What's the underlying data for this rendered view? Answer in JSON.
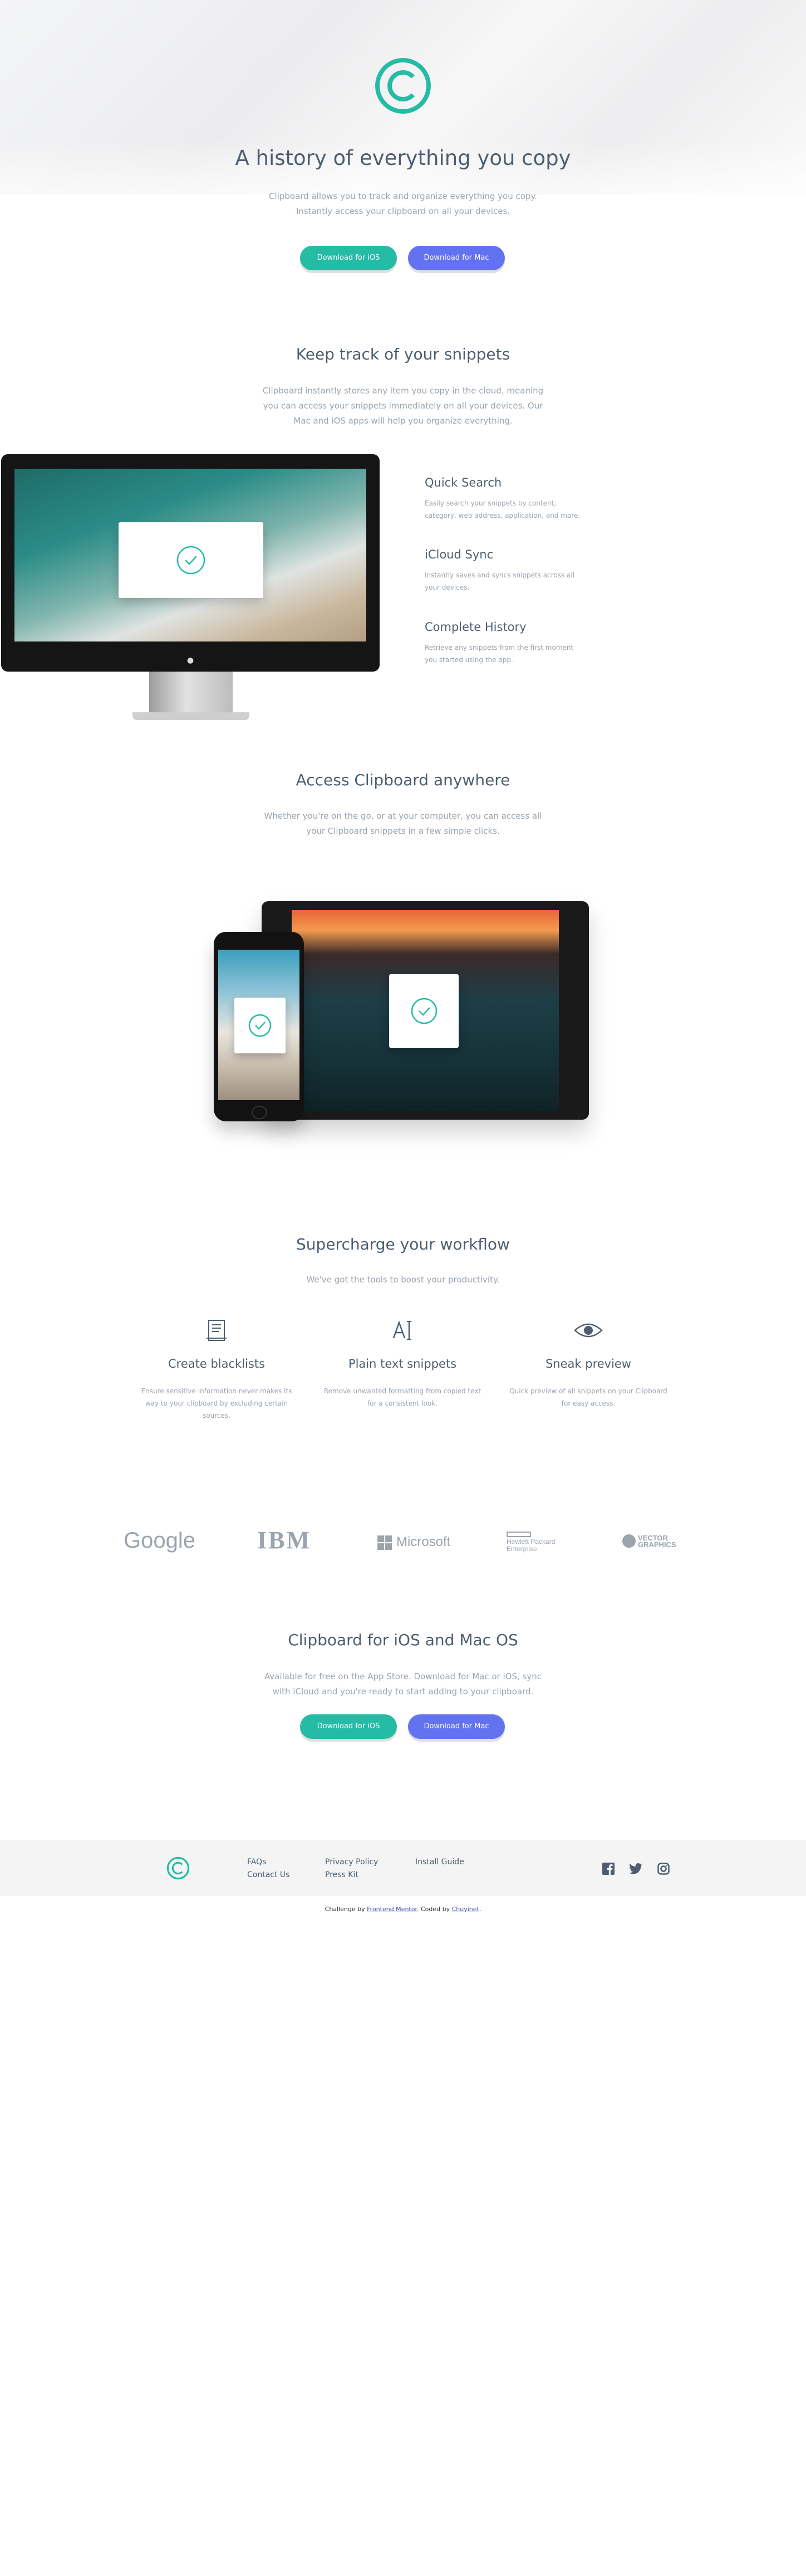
{
  "colors": {
    "accent": "#25bba4",
    "mac": "#6373f0",
    "heading": "#4c5e70",
    "body": "#9aa4ae"
  },
  "hero": {
    "title": "A history of everything you copy",
    "text": "Clipboard allows you to track and organize everything you copy. Instantly access your clipboard on all your devices.",
    "ios_button": "Download for iOS",
    "mac_button": "Download for Mac"
  },
  "snippets": {
    "title": "Keep track of your snippets",
    "text": "Clipboard instantly stores any item you copy in the cloud, meaning you can access your snippets immediately on all your devices. Our Mac and iOS apps will help you organize everything.",
    "features": [
      {
        "title": "Quick Search",
        "text": "Easily search your snippets by content, category, web address, application, and more."
      },
      {
        "title": "iCloud Sync",
        "text": "Instantly saves and syncs snippets across all your devices."
      },
      {
        "title": "Complete History",
        "text": "Retrieve any snippets from the first moment you started using the app."
      }
    ]
  },
  "access": {
    "title": "Access Clipboard anywhere",
    "text": "Whether you're on the go, or at your computer, you can access all your Clipboard snippets in a few simple clicks."
  },
  "workflow": {
    "title": "Supercharge your workflow",
    "text": "We've got the tools to boost your productivity.",
    "items": [
      {
        "icon": "blacklist-icon",
        "title": "Create blacklists",
        "text": "Ensure sensitive information never makes its way to your clipboard by excluding certain sources."
      },
      {
        "icon": "text-icon",
        "title": "Plain text snippets",
        "text": "Remove unwanted formatting from copied text for a consistent look."
      },
      {
        "icon": "eye-icon",
        "title": "Sneak preview",
        "text": "Quick preview of all snippets on your Clipboard for easy access."
      }
    ]
  },
  "partners": [
    "Google",
    "IBM",
    "Microsoft",
    "Hewlett Packard",
    "Enterprise",
    "VECTOR",
    "GRAPHICS"
  ],
  "cta": {
    "title": "Clipboard for iOS and Mac OS",
    "text": "Available for free on the App Store. Download for Mac or iOS, sync with iCloud and you're ready to start adding to your clipboard.",
    "ios_button": "Download for iOS",
    "mac_button": "Download for Mac"
  },
  "footer": {
    "links": [
      "FAQs",
      "Contact Us",
      "Privacy Policy",
      "Press Kit",
      "Install Guide"
    ],
    "social": [
      "facebook-icon",
      "twitter-icon",
      "instagram-icon"
    ]
  },
  "attribution": {
    "prefix": "Challenge by ",
    "fm": "Frontend Mentor",
    "mid": ". Coded by ",
    "author": "Chuyinet",
    "suffix": "."
  }
}
